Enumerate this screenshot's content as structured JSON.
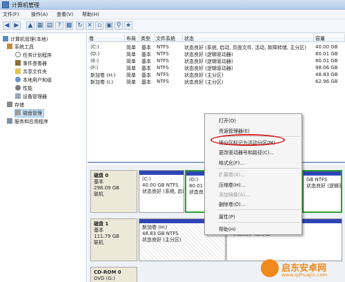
{
  "window": {
    "title": "计算机管理"
  },
  "menu": {
    "items": [
      "文件(F)",
      "操作(A)",
      "查看(V)",
      "帮助(H)"
    ]
  },
  "tree": {
    "items": [
      {
        "label": "计算机管理(本地)",
        "icon": "computer-icon"
      },
      {
        "label": "系统工具",
        "icon": "tools-icon"
      },
      {
        "label": "任务计划程序",
        "icon": "clock-icon"
      },
      {
        "label": "事件查看器",
        "icon": "event-viewer-icon"
      },
      {
        "label": "共享文件夹",
        "icon": "folder-icon"
      },
      {
        "label": "本地用户和组",
        "icon": "users-icon"
      },
      {
        "label": "性能",
        "icon": "performance-icon"
      },
      {
        "label": "设备管理器",
        "icon": "device-icon"
      },
      {
        "label": "存储",
        "icon": "storage-icon"
      },
      {
        "label": "磁盘管理",
        "icon": "disk-icon"
      },
      {
        "label": "服务和应用程序",
        "icon": "services-icon"
      }
    ]
  },
  "volume_list": {
    "columns": [
      "卷",
      "布局",
      "类型",
      "文件系统",
      "状态",
      "容量"
    ],
    "rows": [
      [
        "(C:)",
        "简单",
        "基本",
        "NTFS",
        "状态良好 (系统, 启动, 页面文件, 活动, 故障转储, 主分区)",
        "40.00 GB"
      ],
      [
        "(D:)",
        "简单",
        "基本",
        "NTFS",
        "状态良好 (逻辑驱动器)",
        "80.01 GB"
      ],
      [
        "(E:)",
        "简单",
        "基本",
        "NTFS",
        "状态良好 (逻辑驱动器)",
        "80.01 GB"
      ],
      [
        "(F:)",
        "简单",
        "基本",
        "NTFS",
        "状态良好 (逻辑驱动器)",
        "98.06 GB"
      ],
      [
        "新加卷 (H:)",
        "简单",
        "基本",
        "NTFS",
        "状态良好 (主分区)",
        "48.83 GB"
      ],
      [
        "新加卷 (I:)",
        "简单",
        "基本",
        "NTFS",
        "状态良好 (主分区)",
        "62.96 GB"
      ]
    ]
  },
  "disks": [
    {
      "name": "磁盘 0",
      "type": "基本",
      "size": "298.09 GB",
      "status": "联机",
      "partitions": [
        {
          "label": "(C:)",
          "detail": "40.00 GB NTFS",
          "status": "状态良好 (系统, 启动"
        },
        {
          "label": "(D:)",
          "detail": "80.01",
          "status": "状态良"
        },
        {
          "label": "",
          "detail": "GB NTFS",
          "status": "状态良好 (逻辑驱"
        }
      ]
    },
    {
      "name": "磁盘 1",
      "type": "基本",
      "size": "111.79 GB",
      "status": "联机",
      "partitions": [
        {
          "label": "新加卷 (H:)",
          "detail": "48.83 GB NTFS",
          "status": "状态良好 (主分区)"
        },
        {
          "label": "",
          "detail": "62.96 GB NTFS",
          "status": "状态良好 (主分区)"
        }
      ]
    },
    {
      "name": "CD-ROM 0",
      "type": "DVD (G:)",
      "size": "",
      "status": "",
      "partitions": []
    }
  ],
  "context_menu": {
    "items": [
      {
        "label": "打开(O)",
        "enabled": true
      },
      {
        "label": "资源管理器(E)",
        "enabled": true
      },
      {
        "label": "将分区标记为活动分区(M)",
        "enabled": true,
        "highlighted": true
      },
      {
        "label": "更改驱动器号和路径(C)...",
        "enabled": true
      },
      {
        "label": "格式化(F)...",
        "enabled": true
      },
      {
        "label": "扩展卷(X)...",
        "enabled": false
      },
      {
        "label": "压缩卷(H)...",
        "enabled": true
      },
      {
        "label": "添加镜像(A)...",
        "enabled": false
      },
      {
        "label": "删除卷(D)...",
        "enabled": true
      },
      {
        "label": "属性(P)",
        "enabled": true
      },
      {
        "label": "帮助(H)",
        "enabled": true
      }
    ]
  },
  "watermark": {
    "brand": "启东安卓网",
    "url": "www.qdhuajin.com"
  },
  "colors": {
    "partition_bar": "#2f43b6",
    "selected_outline": "#2e9e2e",
    "annotation_red": "#d11f1f",
    "watermark": "#f08a1c"
  }
}
